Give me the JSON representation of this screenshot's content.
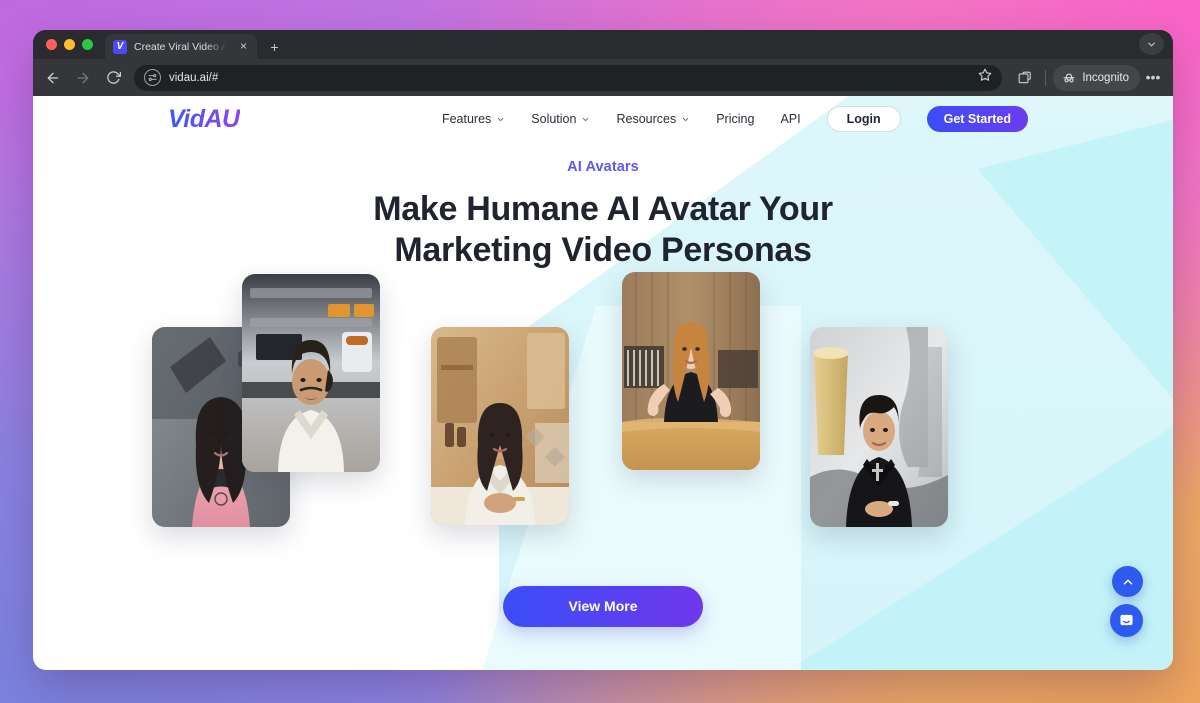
{
  "browser": {
    "tab": {
      "title": "Create Viral Video Ads with Vi",
      "favicon_letter": "V",
      "close_label": "×"
    },
    "new_tab_label": "+",
    "url": "vidau.ai/#",
    "profile_label": "Incognito",
    "icons": {
      "back": "back-arrow-icon",
      "forward": "forward-arrow-icon",
      "reload": "reload-icon",
      "site_settings": "tune-icon",
      "bookmark": "star-icon",
      "extensions": "extensions-icon",
      "incognito": "incognito-hat-icon",
      "menu": "kebab-menu-icon",
      "window_controls": "chevron-down-icon"
    }
  },
  "site": {
    "logo": "VidAU",
    "nav": [
      {
        "label": "Features",
        "has_dropdown": true
      },
      {
        "label": "Solution",
        "has_dropdown": true
      },
      {
        "label": "Resources",
        "has_dropdown": true
      },
      {
        "label": "Pricing",
        "has_dropdown": false
      },
      {
        "label": "API",
        "has_dropdown": false
      }
    ],
    "login_label": "Login",
    "get_started_label": "Get Started",
    "hero": {
      "eyebrow": "AI Avatars",
      "headline_line1": "Make Humane AI Avatar Your",
      "headline_line2": "Marketing Video Personas"
    },
    "avatars": [
      {
        "name": "avatar-card-1",
        "alt": "Woman with long dark hair in pink top, gym background"
      },
      {
        "name": "avatar-card-2",
        "alt": "Man in white polo shirt, kitchen background"
      },
      {
        "name": "avatar-card-3",
        "alt": "Woman in white shirt, warm wooden kitchen background"
      },
      {
        "name": "avatar-card-4",
        "alt": "Woman in black top at wooden counter"
      },
      {
        "name": "avatar-card-5",
        "alt": "Man in black sleeveless top, textured wall background"
      }
    ],
    "view_more_label": "View More",
    "floating": {
      "scroll_top": "chevron-up-icon",
      "chat": "chat-bubble-icon"
    }
  },
  "colors": {
    "brand_blue": "#3b4ef7",
    "brand_purple": "#6f37ec",
    "eyebrow": "#5b5bf0",
    "headline": "#20242e",
    "deco_cyan": "#d9f6fb",
    "fab_blue": "#2e5bef"
  }
}
